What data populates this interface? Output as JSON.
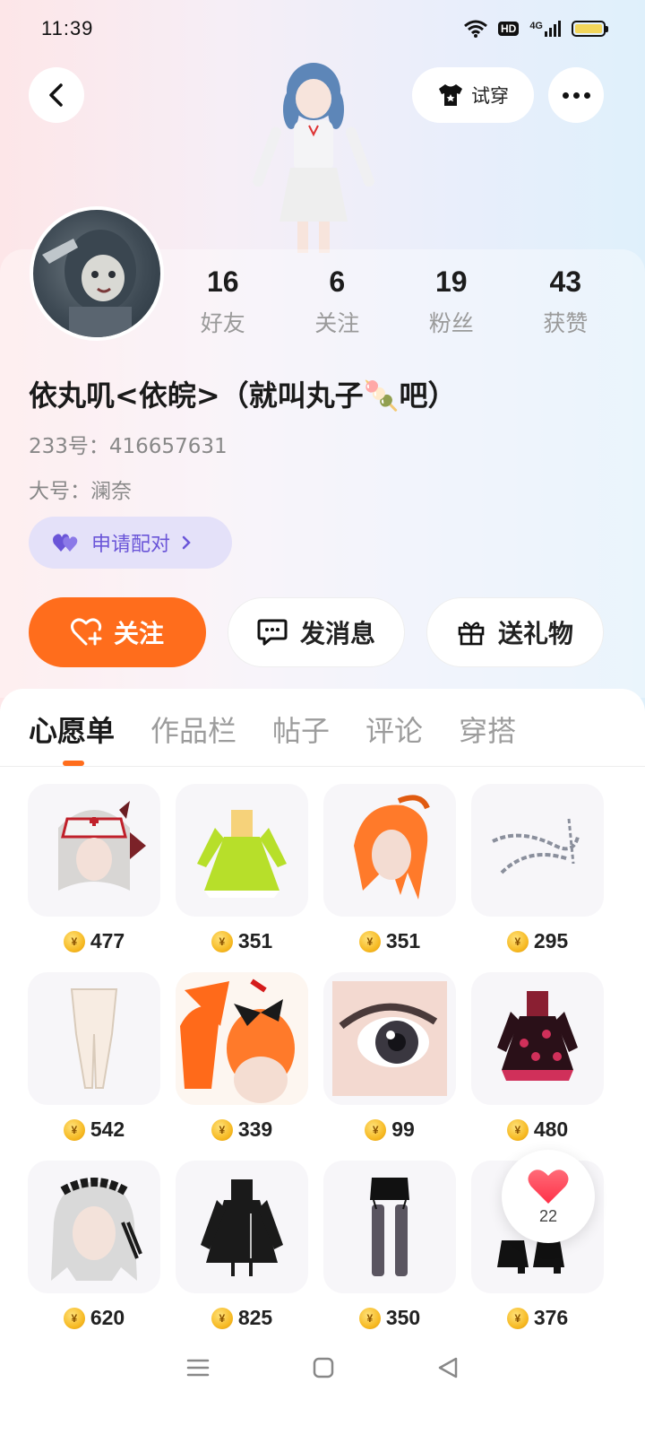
{
  "status_bar": {
    "time": "11:39",
    "hd_label": "HD",
    "network_label": "4G"
  },
  "header": {
    "try_on_label": "试穿"
  },
  "profile": {
    "stats": [
      {
        "value": "16",
        "label": "好友"
      },
      {
        "value": "6",
        "label": "关注"
      },
      {
        "value": "19",
        "label": "粉丝"
      },
      {
        "value": "43",
        "label": "获赞"
      }
    ],
    "nickname": "依丸叽<依皖>（就叫丸子🍡吧）",
    "id_line": "233号：416657631",
    "alt_line": "大号：澜奈",
    "pair_label": "申请配对"
  },
  "actions": {
    "follow_label": "关注",
    "message_label": "发消息",
    "gift_label": "送礼物"
  },
  "tabs": [
    {
      "label": "心愿单",
      "active": true
    },
    {
      "label": "作品栏",
      "active": false
    },
    {
      "label": "帖子",
      "active": false
    },
    {
      "label": "评论",
      "active": false
    },
    {
      "label": "穿搭",
      "active": false
    }
  ],
  "wishlist": [
    {
      "icon": "nurse-hat-hair-icon",
      "price": "477"
    },
    {
      "icon": "green-dress-icon",
      "price": "351"
    },
    {
      "icon": "orange-ponytail-hair-icon",
      "price": "351"
    },
    {
      "icon": "chain-accessory-icon",
      "price": "295"
    },
    {
      "icon": "stockings-icon",
      "price": "542"
    },
    {
      "icon": "orange-bow-hair-icon",
      "price": "339"
    },
    {
      "icon": "eye-makeup-icon",
      "price": "99"
    },
    {
      "icon": "gothic-dress-icon",
      "price": "480"
    },
    {
      "icon": "maid-headdress-hair-icon",
      "price": "620"
    },
    {
      "icon": "black-dress-icon",
      "price": "825"
    },
    {
      "icon": "garter-stockings-icon",
      "price": "350"
    },
    {
      "icon": "black-boots-icon",
      "price": "376"
    }
  ],
  "like_fab": {
    "count": "22"
  },
  "colors": {
    "accent": "#ff6d1c",
    "pair": "#6a55d8",
    "like": "#ff4d5e"
  }
}
